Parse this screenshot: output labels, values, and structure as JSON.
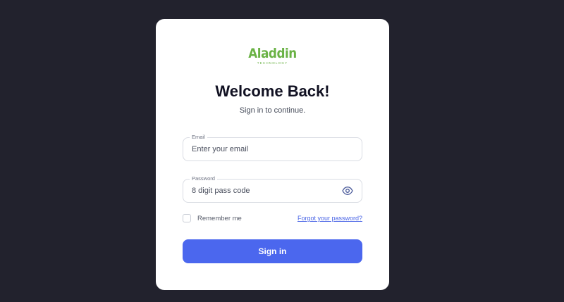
{
  "colors": {
    "background": "#22222d",
    "card": "#ffffff",
    "brand_green": "#6ab245",
    "primary": "#4b67ee",
    "link": "#4a65e6"
  },
  "logo": {
    "wordmark": "Aladdin",
    "tagline": "TECHNOLOGY"
  },
  "login": {
    "title": "Welcome Back!",
    "subtitle": "Sign in to continue.",
    "email": {
      "label": "Email",
      "placeholder": "Enter your email",
      "value": ""
    },
    "password": {
      "label": "Password",
      "placeholder": "8 digit pass code",
      "value": "",
      "toggle_icon": "eye-icon"
    },
    "remember_label": "Remember me",
    "remember_checked": false,
    "forgot_label": "Forgot your password?",
    "submit_label": "Sign in"
  }
}
